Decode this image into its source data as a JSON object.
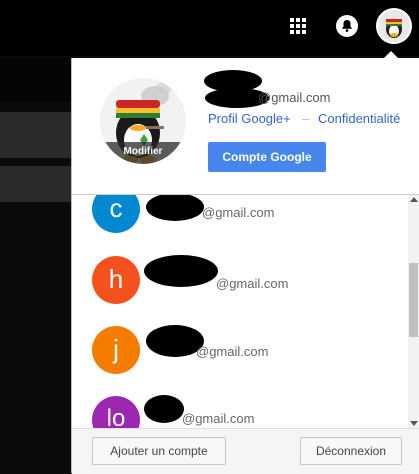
{
  "topbar": {
    "apps_icon": "apps-grid-icon",
    "notifications_icon": "bell-icon"
  },
  "profile": {
    "email_suffix": "@gmail.com",
    "modify_label": "Modifier",
    "profile_link": "Profil Google+",
    "separator": "–",
    "privacy_link": "Confidentialité",
    "account_button": "Compte Google"
  },
  "accounts": [
    {
      "initial": "c",
      "email_suffix": "@gmail.com",
      "color": "#0288d1"
    },
    {
      "initial": "h",
      "email_suffix": "@gmail.com",
      "color": "#f4511e"
    },
    {
      "initial": "j",
      "email_suffix": "@gmail.com",
      "color": "#f57c00"
    },
    {
      "initial": "lo",
      "email_suffix": "@gmail.com",
      "color": "#9c27b0"
    }
  ],
  "footer": {
    "add_account": "Ajouter un compte",
    "sign_out": "Déconnexion"
  },
  "colors": {
    "accent_button": "#4787ed",
    "link": "#3366cc"
  }
}
